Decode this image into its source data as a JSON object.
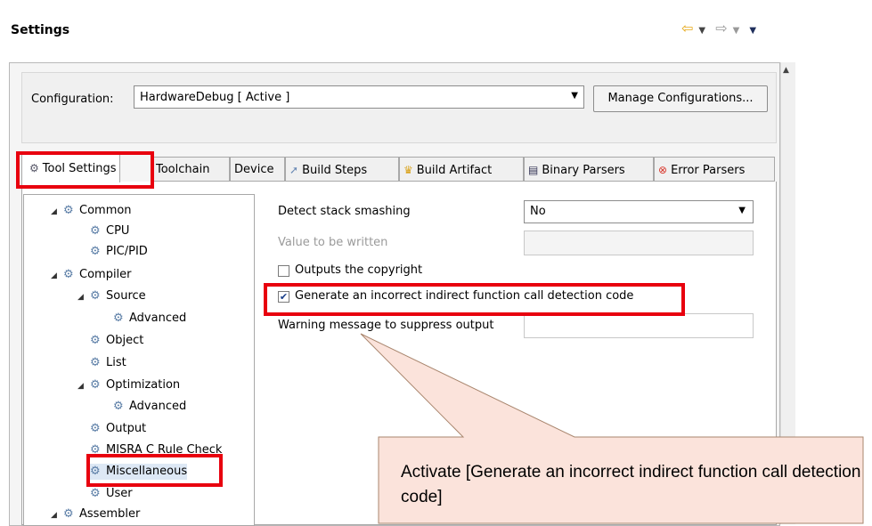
{
  "header": {
    "title": "Settings"
  },
  "configuration": {
    "label": "Configuration:",
    "selected": "HardwareDebug  [ Active ]",
    "manage_button": "Manage Configurations..."
  },
  "tabs": [
    {
      "label": "Tool Settings",
      "icon": "gear-icon",
      "active": true
    },
    {
      "label": "Toolchain",
      "icon": ""
    },
    {
      "label": "Device",
      "icon": ""
    },
    {
      "label": "Build Steps",
      "icon": "build-steps-icon"
    },
    {
      "label": "Build Artifact",
      "icon": "trophy-icon"
    },
    {
      "label": "Binary Parsers",
      "icon": "binary-icon"
    },
    {
      "label": "Error Parsers",
      "icon": "error-icon"
    }
  ],
  "tree": {
    "items": [
      {
        "label": "Common",
        "level": 0,
        "expanded": true
      },
      {
        "label": "CPU",
        "level": 1
      },
      {
        "label": "PIC/PID",
        "level": 1
      },
      {
        "label": "Compiler",
        "level": 0,
        "expanded": true
      },
      {
        "label": "Source",
        "level": 1,
        "expanded": true
      },
      {
        "label": "Advanced",
        "level": 2
      },
      {
        "label": "Object",
        "level": 1
      },
      {
        "label": "List",
        "level": 1
      },
      {
        "label": "Optimization",
        "level": 1,
        "expanded": true
      },
      {
        "label": "Advanced",
        "level": 2
      },
      {
        "label": "Output",
        "level": 1
      },
      {
        "label": "MISRA C Rule Check",
        "level": 1
      },
      {
        "label": "Miscellaneous",
        "level": 1,
        "selected": true
      },
      {
        "label": "User",
        "level": 1
      },
      {
        "label": "Assembler",
        "level": 0,
        "expanded": true
      }
    ]
  },
  "options": {
    "stack_label": "Detect stack smashing",
    "stack_value": "No",
    "value_label": "Value to be written",
    "copyright_label": "Outputs the copyright",
    "copyright_checked": false,
    "generate_label": "Generate an incorrect indirect function call detection code",
    "generate_checked": true,
    "warning_label": "Warning message to suppress output"
  },
  "callout": {
    "text": "Activate [Generate an incorrect indirect function call detection code]"
  },
  "colors": {
    "highlight": "#e8000e",
    "callout_fill": "#fbe3db",
    "callout_stroke": "#a9866e"
  }
}
